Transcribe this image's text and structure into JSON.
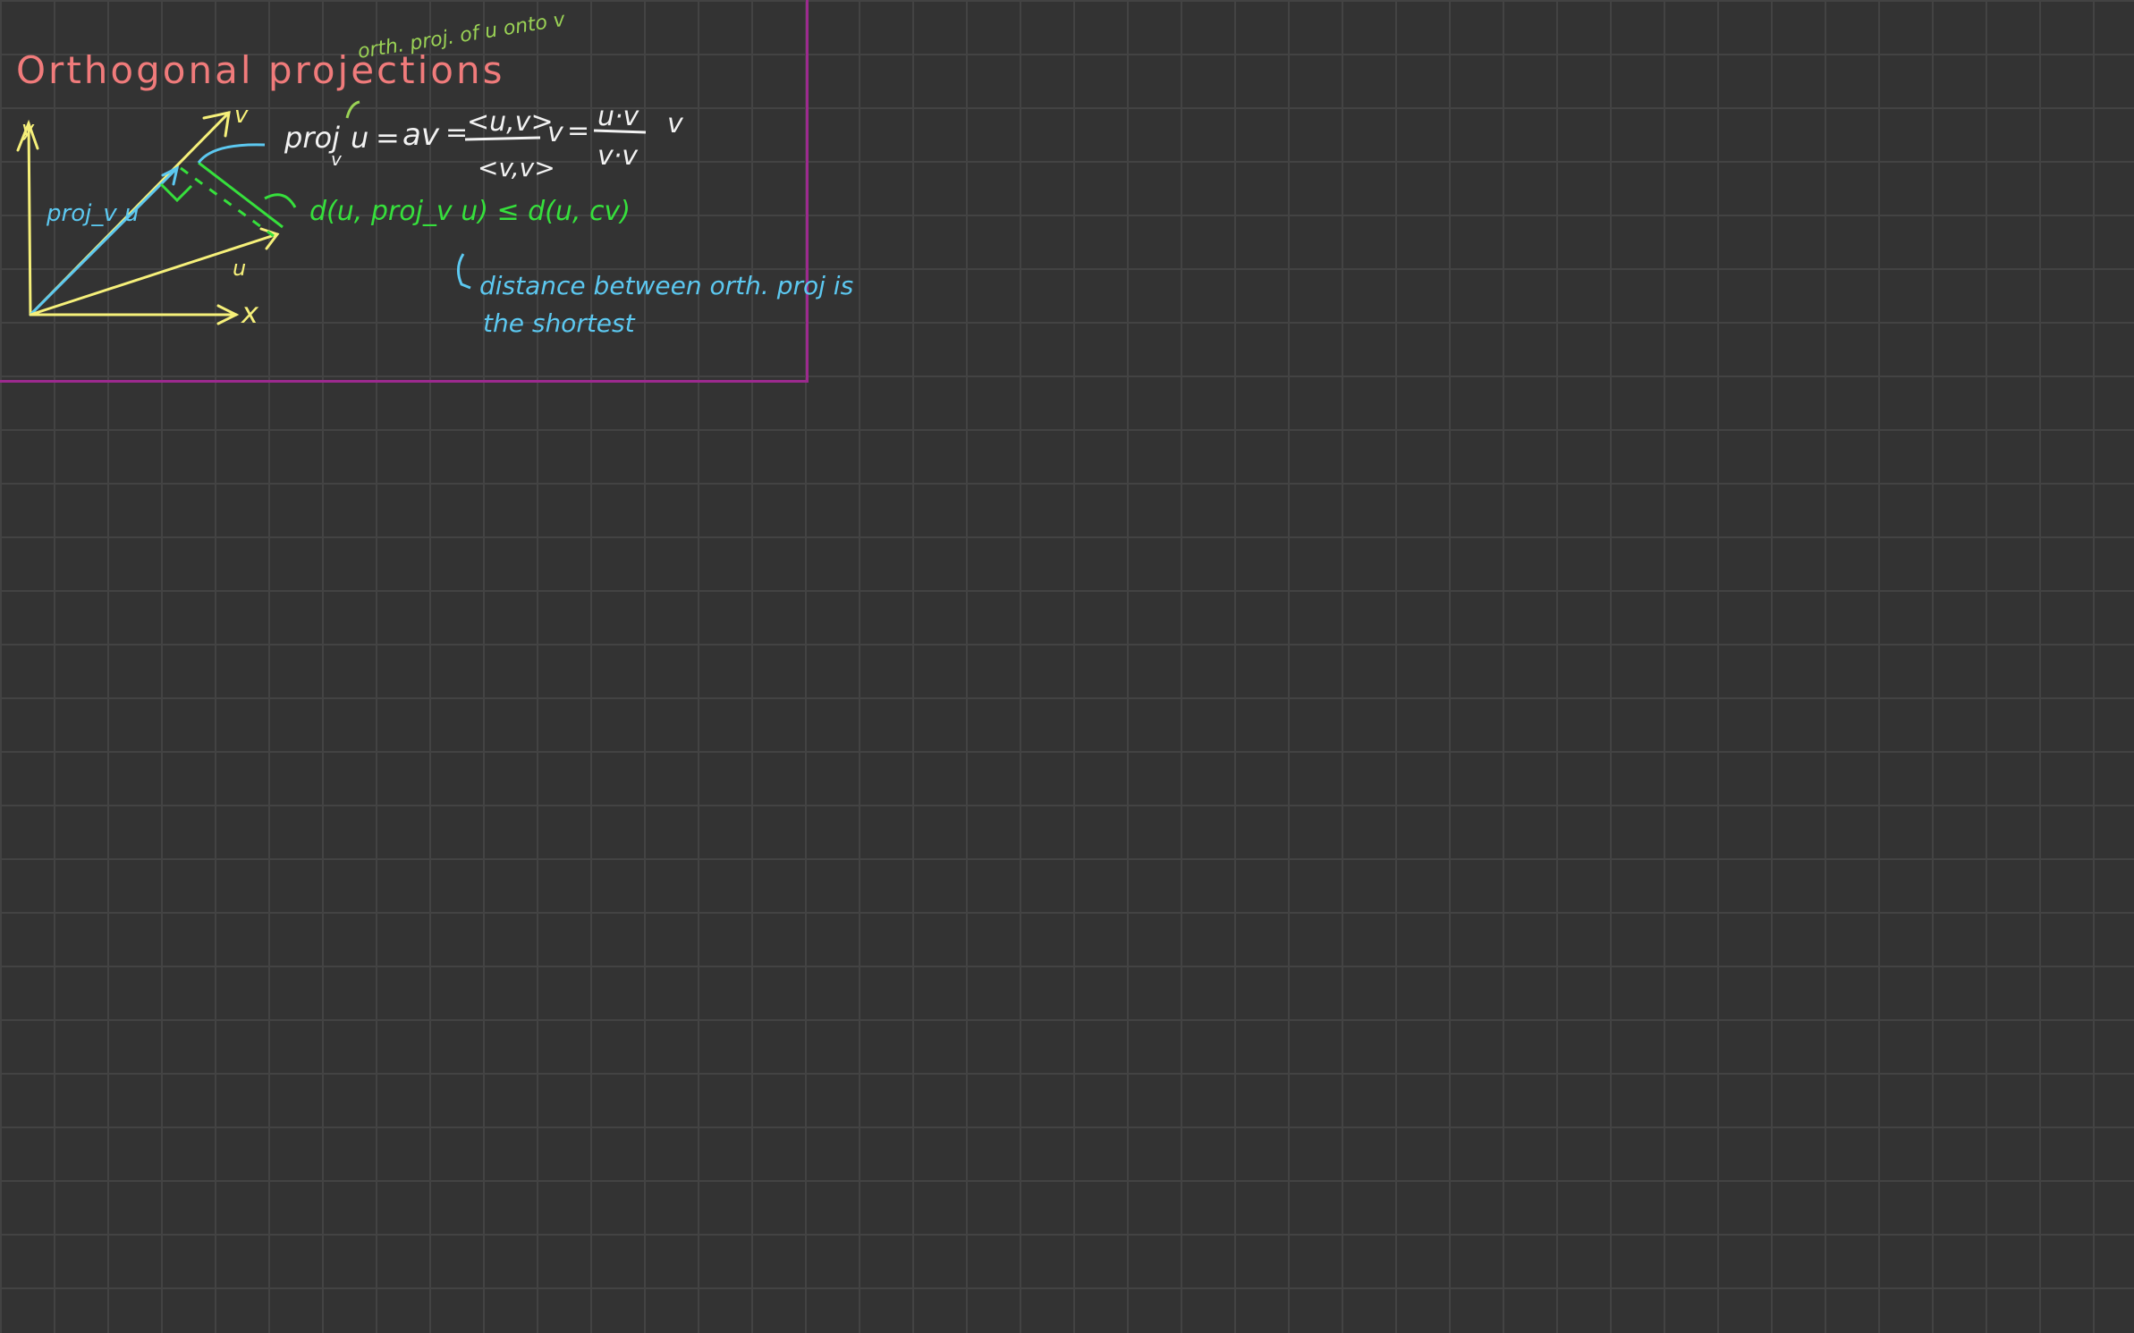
{
  "colors": {
    "background": "#333333",
    "grid": "#434343",
    "frame": "#9c2a8e",
    "title": "#f07b7b",
    "white": "#f2f2f2",
    "yellow": "#f6f07a",
    "cyan": "#5cc8f0",
    "green": "#36e03c",
    "light_green": "#9ad255"
  },
  "title": "Orthogonal projections",
  "note_orth": "orth. proj. of u onto v",
  "formula": {
    "proj": "proj",
    "sub_v": "v",
    "u": "u",
    "eq1": "=",
    "av": "av",
    "eq2": "=",
    "num1": "<u,v>",
    "den1": "<v,v>",
    "v1": "v",
    "eq3": "=",
    "num2": "u·v",
    "den2": "v·v",
    "v2": "v"
  },
  "inequality": "d(u, proj_v u) ≤ d(u, cv)",
  "distance_note": {
    "line1": "distance between  orth. proj is",
    "line2": "the shortest"
  },
  "diagram": {
    "y_label": "y",
    "v_label": "v",
    "projvu_label": "proj_v u",
    "u_label": "u",
    "x_label": "x"
  }
}
